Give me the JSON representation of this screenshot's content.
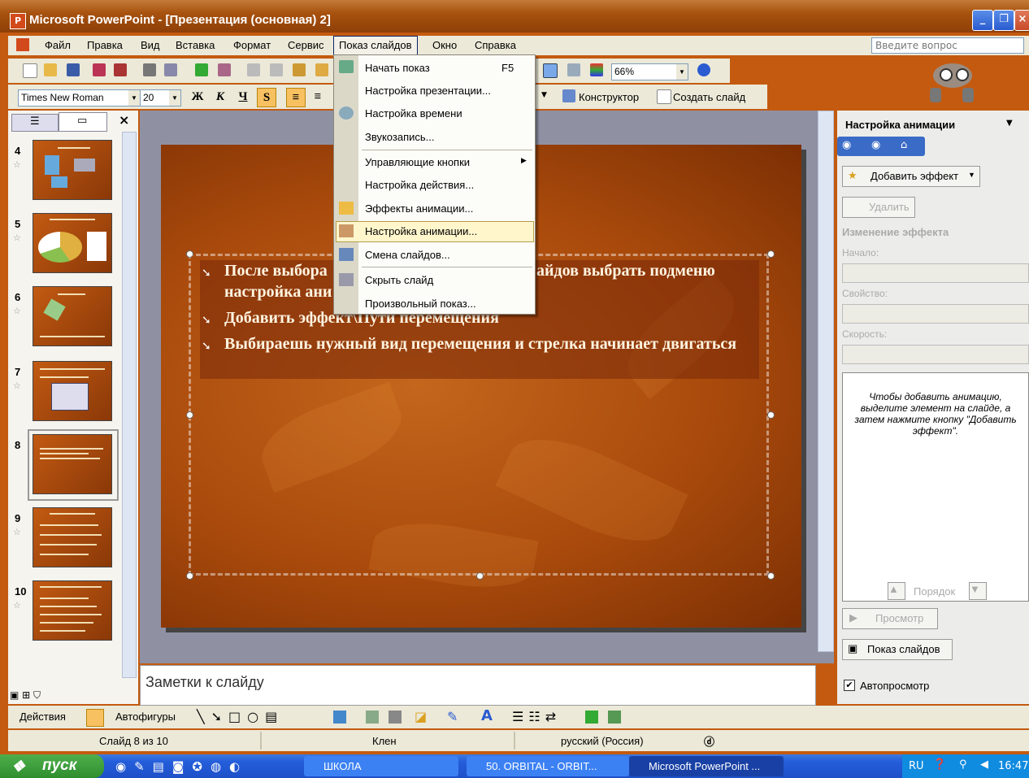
{
  "window": {
    "title": "Microsoft PowerPoint - [Презентация (основная) 2]",
    "icon_label": "P"
  },
  "menubar": {
    "items": [
      "Файл",
      "Правка",
      "Вид",
      "Вставка",
      "Формат",
      "Сервис",
      "Показ слайдов",
      "Окно",
      "Справка"
    ],
    "active": "Показ слайдов",
    "ask_placeholder": "Введите вопрос"
  },
  "standard_toolbar": {
    "zoom": "66%"
  },
  "formatting_toolbar": {
    "font_name": "Times New Roman",
    "font_size": "20",
    "bold": "Ж",
    "italic": "К",
    "underline": "Ч",
    "shadow": "S",
    "designer_label": "Конструктор",
    "new_slide_label": "Создать слайд"
  },
  "slideshow_menu": {
    "items": [
      {
        "label": "Начать показ",
        "shortcut": "F5",
        "icon": "projector-icon"
      },
      {
        "label": "Настройка презентации...",
        "icon": ""
      },
      {
        "label": "Настройка времени",
        "icon": "timer-icon"
      },
      {
        "label": "Звукозапись...",
        "icon": ""
      },
      {
        "label": "Управляющие кнопки",
        "icon": "",
        "submenu": true
      },
      {
        "label": "Настройка действия...",
        "icon": ""
      },
      {
        "label": "Эффекты анимации...",
        "icon": "star-icon"
      },
      {
        "label": "Настройка анимации...",
        "icon": "animation-icon",
        "highlighted": true
      },
      {
        "label": "Смена слайдов...",
        "icon": "transition-icon"
      },
      {
        "label": "Скрыть слайд",
        "icon": "hide-slide-icon"
      },
      {
        "label": "Произвольный показ...",
        "icon": ""
      }
    ]
  },
  "thumbnails": {
    "tabs": [
      "outline-tab",
      "slides-tab"
    ],
    "close": "×",
    "slides": [
      {
        "num": "4"
      },
      {
        "num": "5"
      },
      {
        "num": "6"
      },
      {
        "num": "7"
      },
      {
        "num": "8",
        "selected": true
      },
      {
        "num": "9"
      },
      {
        "num": "10"
      }
    ]
  },
  "slide": {
    "bullets": [
      "После выбора",
      "айдов выбрать подменю",
      "настройка ани",
      "Добавить эффект\\Пути перемещения",
      "Выбираешь нужный вид перемещения и стрелка начинает двигаться"
    ]
  },
  "notes": {
    "placeholder": "Заметки к слайду"
  },
  "taskpane": {
    "title": "Настройка анимации",
    "add_effect": "Добавить эффект",
    "remove": "Удалить",
    "modify_header": "Изменение эффекта",
    "start_label": "Начало:",
    "property_label": "Свойство:",
    "speed_label": "Скорость:",
    "hint": "Чтобы добавить анимацию, выделите элемент на слайде, а затем нажмите кнопку \"Добавить эффект\".",
    "order_label": "Порядок",
    "preview_label": "Просмотр",
    "slideshow_label": "Показ слайдов",
    "autopreview_label": "Автопросмотр",
    "autopreview_checked": true
  },
  "drawing_toolbar": {
    "actions": "Действия",
    "autoshapes": "Автофигуры"
  },
  "statusbar": {
    "slide_info": "Слайд 8 из 10",
    "design": "Клен",
    "language": "русский (Россия)"
  },
  "taskbar": {
    "start": "пуск",
    "tasks": [
      "ШКОЛА",
      "50. ORBITAL - ORBIT...",
      "Microsoft PowerPoint ..."
    ],
    "lang": "RU",
    "time": "16:47"
  },
  "colors": {
    "accent": "#c45a10",
    "title_bar": "#a8520e",
    "taskbar": "#245edb",
    "start": "#2f8f2e"
  }
}
